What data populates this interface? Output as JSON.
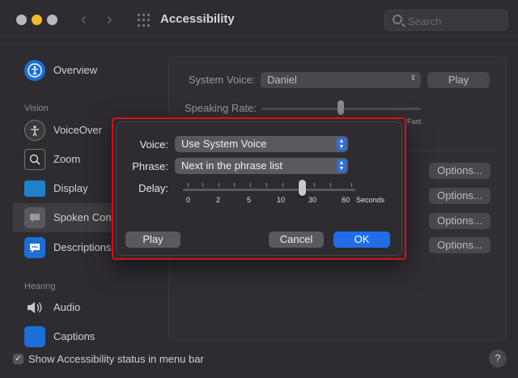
{
  "window": {
    "title": "Accessibility"
  },
  "search": {
    "placeholder": "Search"
  },
  "sidebar": {
    "items": [
      {
        "label": "Overview",
        "icon": "accessibility-icon"
      },
      {
        "label": "VoiceOver",
        "icon": "voiceover-icon"
      },
      {
        "label": "Zoom",
        "icon": "zoom-icon"
      },
      {
        "label": "Display",
        "icon": "display-icon"
      },
      {
        "label": "Spoken Content",
        "icon": "speech-bubble-icon"
      },
      {
        "label": "Descriptions",
        "icon": "descriptions-icon"
      },
      {
        "label": "Audio",
        "icon": "speaker-icon"
      },
      {
        "label": "Captions",
        "icon": "captions-icon"
      }
    ],
    "sections": {
      "vision": "Vision",
      "hearing": "Hearing"
    }
  },
  "main": {
    "system_voice_label": "System Voice:",
    "system_voice_value": "Daniel",
    "play_label": "Play",
    "speaking_rate_label": "Speaking Rate:",
    "fast_label": "Fast",
    "options_label": "Options..."
  },
  "dialog": {
    "voice_label": "Voice:",
    "voice_value": "Use System Voice",
    "phrase_label": "Phrase:",
    "phrase_value": "Next in the phrase list",
    "delay_label": "Delay:",
    "delay_ticks": [
      "0",
      "2",
      "5",
      "10",
      "30",
      "60"
    ],
    "delay_unit": "Seconds",
    "play_button": "Play",
    "cancel_button": "Cancel",
    "ok_button": "OK"
  },
  "footer": {
    "status_checkbox_label": "Show Accessibility status in menu bar",
    "help_label": "?"
  },
  "colors": {
    "accent": "#1f6ee8",
    "highlight_border": "#d8101a",
    "window_bg": "#2e2c31"
  }
}
